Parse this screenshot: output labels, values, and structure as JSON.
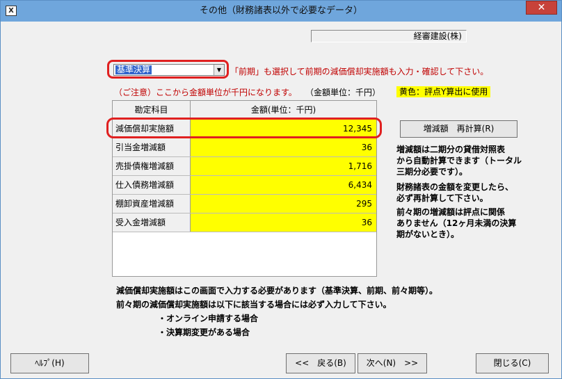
{
  "window": {
    "title": "その他（財務諸表以外で必要なデータ）",
    "app_icon": "x-icon",
    "close_label": "✕"
  },
  "company": "経審建設(株)",
  "select": {
    "value": "基準決算",
    "note": "「前期」も選択して前期の減価償却実施額も入力・確認して下さい。"
  },
  "caution": "（ご注意）ここから金額単位が千円になります。",
  "unit_label": "（金額単位：千円）",
  "yellow_note": "黄色：評点Y算出に使用",
  "table": {
    "headers": [
      "勘定科目",
      "金額(単位：千円)"
    ],
    "rows": [
      {
        "name": "減価償却実施額",
        "value": "12,345"
      },
      {
        "name": "引当金増減額",
        "value": "36"
      },
      {
        "name": "売掛債権増減額",
        "value": "1,716"
      },
      {
        "name": "仕入債務増減額",
        "value": "6,434"
      },
      {
        "name": "棚卸資産増減額",
        "value": "295"
      },
      {
        "name": "受入金増減額",
        "value": "36"
      }
    ]
  },
  "recalc_button": "増減額　再計算(R)",
  "side_notes": [
    [
      "増減額は二期分の貸借対照表",
      "から自動計算できます（トータル",
      "三期分必要です）。"
    ],
    [
      "財務諸表の金額を変更したら、",
      "必ず再計算して下さい。"
    ],
    [
      "前々期の増減額は評点に関係",
      "ありません（12ヶ月未満の決算",
      "期がないとき）。"
    ]
  ],
  "bottom_notes": {
    "line1": "減価償却実施額はこの画面で入力する必要があります（基準決算、前期、前々期等）。",
    "line2": "前々期の減価償却実施額は以下に該当する場合には必ず入力して下さい。",
    "bullet1": "・オンライン申請する場合",
    "bullet2": "・決算期変更がある場合"
  },
  "buttons": {
    "help": "ﾍﾙﾌﾟ(H)",
    "back": "<<　戻る(B)",
    "next": "次へ(N)　>>",
    "close": "閉じる(C)"
  }
}
